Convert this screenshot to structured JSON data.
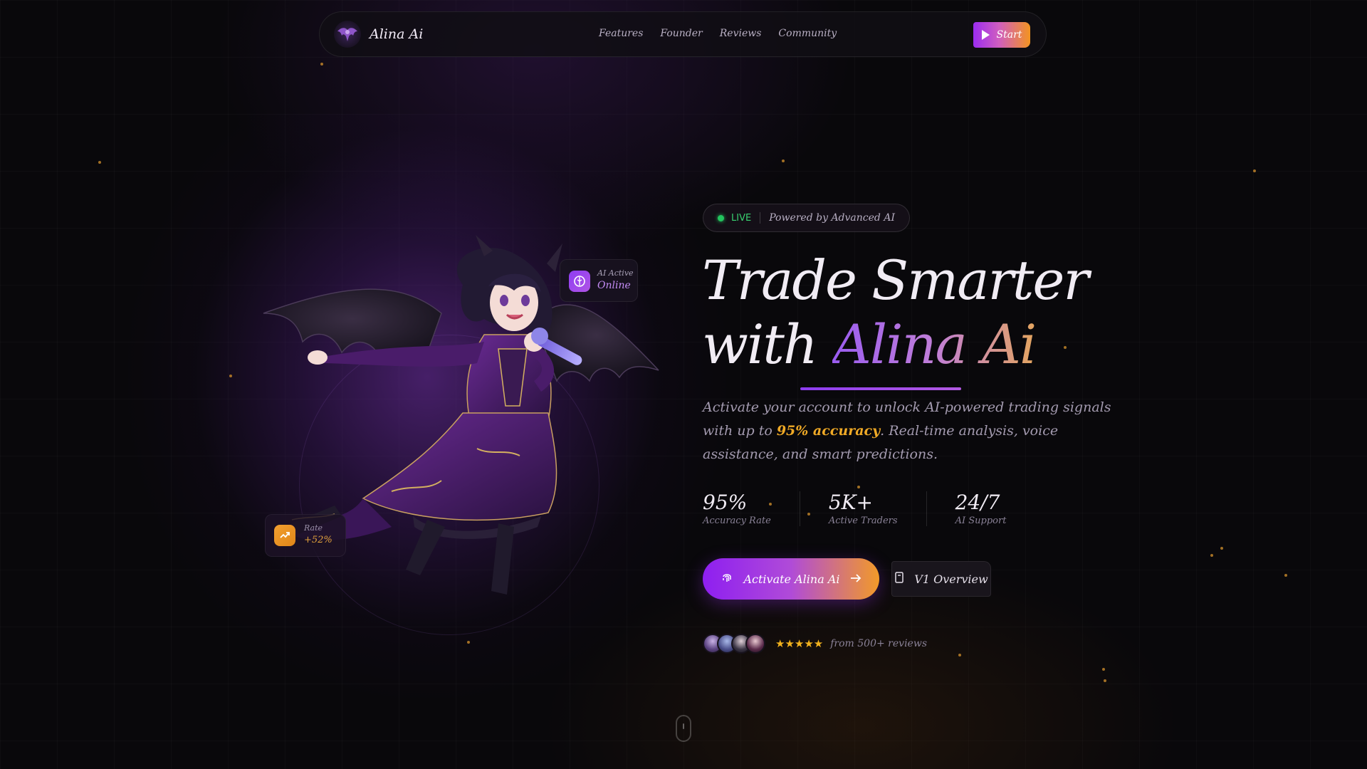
{
  "brand": {
    "name": "Alina Ai"
  },
  "nav": {
    "links": [
      "Features",
      "Founder",
      "Reviews",
      "Community"
    ],
    "start_label": "Start"
  },
  "hero_cards": {
    "ai_status": {
      "label": "AI Active",
      "value": "Online"
    },
    "rate": {
      "label": "Rate",
      "value": "+52%"
    }
  },
  "badge": {
    "live": "LIVE",
    "text": "Powered by Advanced AI"
  },
  "headline": {
    "line1": "Trade Smarter",
    "line2_plain": "with",
    "line2_gradient": "Alina Ai"
  },
  "description": {
    "before": "Activate your account to unlock AI-powered trading signals with up to",
    "accent": "95% accuracy",
    "after": ". Real-time analysis, voice assistance, and smart predictions."
  },
  "stats": [
    {
      "value": "95%",
      "label": "Accuracy Rate"
    },
    {
      "value": "5K+",
      "label": "Active Traders"
    },
    {
      "value": "24/7",
      "label": "AI Support"
    }
  ],
  "actions": {
    "primary_label": "Activate Alina Ai",
    "secondary_label": "V1 Overview"
  },
  "reviews": {
    "stars": "★★★★★",
    "text": "from 500+ reviews"
  },
  "colors": {
    "accent_purple": "#8e1ff0",
    "accent_orange": "#f29a28",
    "live_green": "#23c45e",
    "highlight_gold": "#f0aa26"
  }
}
